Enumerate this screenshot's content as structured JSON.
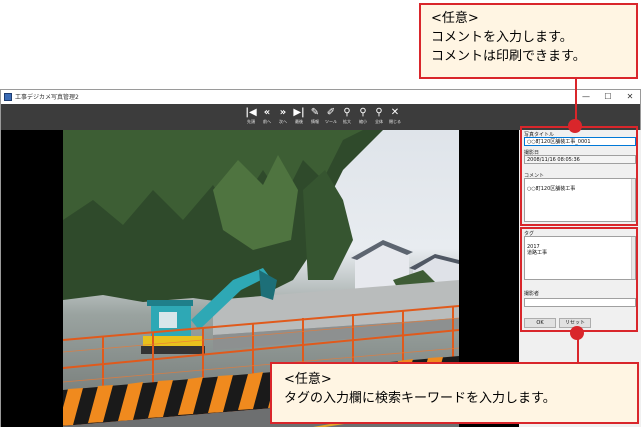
{
  "window": {
    "title": "工事デジカメ写真管理2",
    "controls": {
      "minimize": "—",
      "maximize": "☐",
      "close": "✕"
    }
  },
  "toolbar": {
    "buttons": [
      {
        "icon": "first-icon",
        "glyph": "|◀",
        "label": "先頭"
      },
      {
        "icon": "prev-icon",
        "glyph": "«",
        "label": "前へ"
      },
      {
        "icon": "next-icon",
        "glyph": "»",
        "label": "次へ"
      },
      {
        "icon": "last-icon",
        "glyph": "▶|",
        "label": "最後"
      },
      {
        "icon": "info-icon",
        "glyph": "✎",
        "label": "情報"
      },
      {
        "icon": "tool-icon",
        "glyph": "✐",
        "label": "ツール"
      },
      {
        "icon": "zoom-in-icon",
        "glyph": "⚲",
        "label": "拡大"
      },
      {
        "icon": "zoom-original-icon",
        "glyph": "⚲",
        "label": "縮小"
      },
      {
        "icon": "zoom-fit-icon",
        "glyph": "⚲",
        "label": "全体"
      },
      {
        "icon": "close-icon",
        "glyph": "✕",
        "label": "閉じる"
      }
    ]
  },
  "panel": {
    "photo_title_label": "写真タイトル",
    "photo_title_value": "○○町120区舗装工事_0001",
    "date_label": "撮影日",
    "date_value": "2008/11/16 08:05:36",
    "comment_label": "コメント",
    "comment_value": "○○町120区舗装工事",
    "tag_label": "タグ",
    "tag_value": "2017\n道路工事",
    "photographer_label": "撮影者",
    "photographer_value": "",
    "ok_label": "OK",
    "reset_label": "リセット"
  },
  "callout_top": {
    "heading": "<任意>",
    "line1": "コメントを入力します。",
    "line2": "コメントは印刷できます。"
  },
  "callout_bottom": {
    "heading": "<任意>",
    "line1": "タグの入力欄に検索キーワードを入力します。"
  },
  "colors": {
    "accent": "#d9262b",
    "callout_bg": "#fff5e3",
    "toolbar_bg": "#3c3c3c"
  }
}
